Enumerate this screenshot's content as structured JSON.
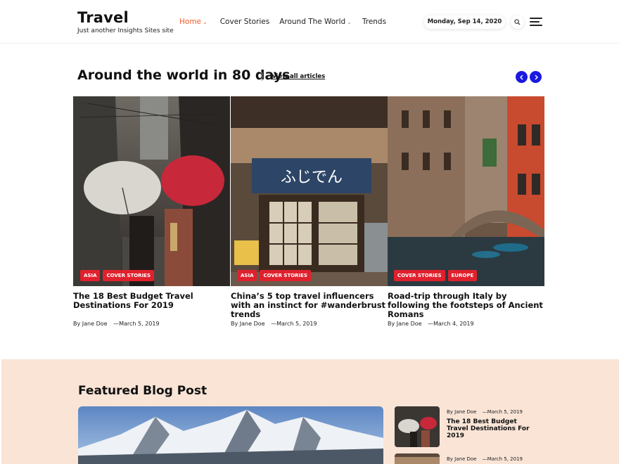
{
  "site": {
    "title": "Travel",
    "tagline": "Just another Insights Sites site"
  },
  "nav": {
    "items": [
      {
        "label": "Home",
        "active": true,
        "has_dropdown": true
      },
      {
        "label": "Cover Stories",
        "active": false,
        "has_dropdown": false
      },
      {
        "label": "Around The World",
        "active": false,
        "has_dropdown": true
      },
      {
        "label": "Trends",
        "active": false,
        "has_dropdown": false
      }
    ],
    "date": "Monday, Sep 14, 2020",
    "icons": {
      "search": "search-icon",
      "menu": "hamburger-menu-icon",
      "dropdown": "chevron-down-icon"
    }
  },
  "around": {
    "title": "Around the world in 80 days",
    "view_all": "view all articles",
    "arrows": {
      "prev": "chevron-left-icon",
      "next": "chevron-right-icon"
    },
    "cards": [
      {
        "tags": [
          "ASIA",
          "COVER STORIES"
        ],
        "title": "The 18 Best Budget Travel Destinations For 2019",
        "author": "By Jane Doe",
        "date": "March 5, 2019",
        "image": "street-with-umbrellas-photo"
      },
      {
        "tags": [
          "ASIA",
          "COVER STORIES"
        ],
        "title": "China’s 5 top travel influencers with an instinct for #wanderbrust trends",
        "author": "By Jane Doe",
        "date": "March 5, 2019",
        "image": "japanese-shopfront-photo"
      },
      {
        "tags": [
          "COVER STORIES",
          "EUROPE"
        ],
        "title": "Road-trip through Italy by following the footsteps of Ancient Romans",
        "author": "By Jane Doe",
        "date": "March 4, 2019",
        "image": "venice-canal-photo"
      }
    ]
  },
  "featured": {
    "title": "Featured Blog Post",
    "main_image": "snowy-mountains-photo",
    "side_posts": [
      {
        "author": "By Jane Doe",
        "date": "March 5, 2019",
        "title": "The 18 Best Budget Travel Destinations For 2019"
      },
      {
        "author": "By Jane Doe",
        "date": "March 5, 2019",
        "title": ""
      }
    ]
  },
  "colors": {
    "accent": "#f25c2b",
    "tag_red": "#e0212d",
    "arrow_blue": "#1a1ae0",
    "featured_bg": "#f9e4d6"
  }
}
